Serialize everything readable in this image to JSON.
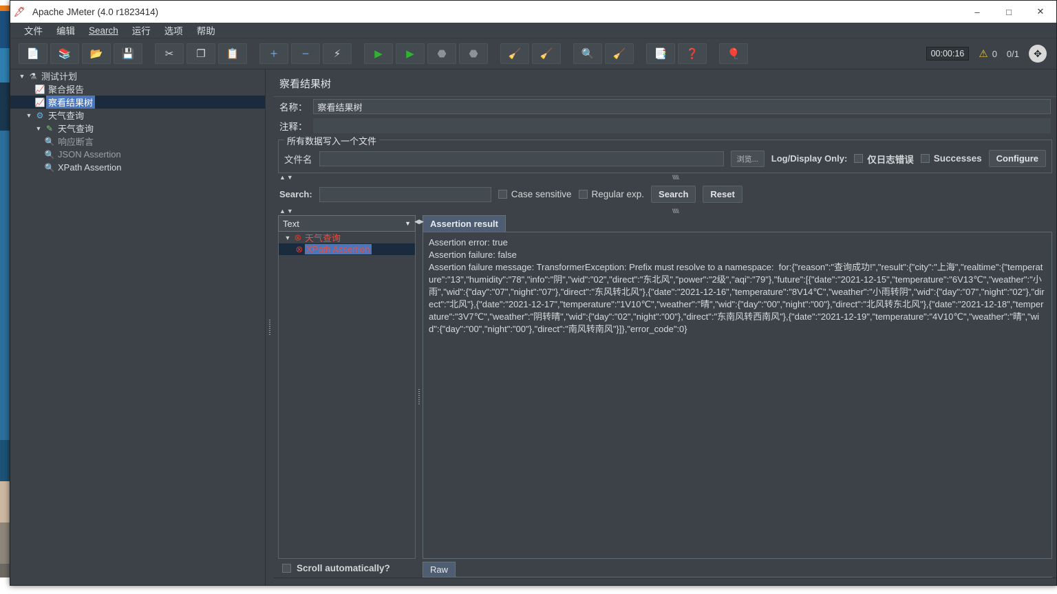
{
  "window": {
    "title": "Apache JMeter (4.0 r1823414)",
    "app_icon": "jmeter-feather-icon",
    "minimize_label": "–",
    "maximize_label": "□",
    "close_label": "✕"
  },
  "menubar": {
    "items": [
      {
        "label": "文件",
        "mnemonic": ""
      },
      {
        "label": "编辑",
        "mnemonic": ""
      },
      {
        "label": "Search",
        "mnemonic": "S"
      },
      {
        "label": "运行",
        "mnemonic": ""
      },
      {
        "label": "选项",
        "mnemonic": ""
      },
      {
        "label": "帮助",
        "mnemonic": ""
      }
    ]
  },
  "toolbar": {
    "buttons": [
      {
        "name": "new-button",
        "glyph": "📄"
      },
      {
        "name": "templates-button",
        "glyph": "📚"
      },
      {
        "name": "open-button",
        "glyph": "📂"
      },
      {
        "name": "save-button",
        "glyph": "💾"
      },
      {
        "name": "cut-button",
        "glyph": "✂"
      },
      {
        "name": "copy-button",
        "glyph": "📋"
      },
      {
        "name": "paste-button",
        "glyph": "📄"
      },
      {
        "name": "expand-all-button",
        "glyph": "+"
      },
      {
        "name": "collapse-all-button",
        "glyph": "−"
      },
      {
        "name": "toggle-button",
        "glyph": "⚡"
      },
      {
        "name": "start-button",
        "glyph": "▶"
      },
      {
        "name": "start-no-pauses-button",
        "glyph": "▶"
      },
      {
        "name": "stop-button",
        "glyph": "⬣"
      },
      {
        "name": "shutdown-button",
        "glyph": "⬣"
      },
      {
        "name": "clear-button",
        "glyph": "🧹"
      },
      {
        "name": "clear-all-button",
        "glyph": "🧹"
      },
      {
        "name": "search-button",
        "glyph": "🔍"
      },
      {
        "name": "reset-search-button",
        "glyph": "🧹"
      },
      {
        "name": "function-helper-button",
        "glyph": "📋"
      },
      {
        "name": "help-button",
        "glyph": "❓"
      },
      {
        "name": "undo-button",
        "glyph": "🎈"
      }
    ],
    "elapsed_time": "00:00:16",
    "warning_count": "0",
    "thread_counts": "0/1",
    "warning_icon": "warning-triangle-icon",
    "status_icon": "connection-status-icon"
  },
  "tree": {
    "nodes": [
      {
        "label": "测试计划",
        "icon": "test-plan-icon",
        "toggle": "▼",
        "depth": 0,
        "state": "normal"
      },
      {
        "label": "聚合报告",
        "icon": "aggregate-report-icon",
        "toggle": "",
        "depth": 1,
        "state": "normal"
      },
      {
        "label": "察看结果树",
        "icon": "view-results-tree-icon",
        "toggle": "",
        "depth": 1,
        "state": "selected"
      },
      {
        "label": "天气查询",
        "icon": "thread-group-icon",
        "toggle": "▼",
        "depth": 1,
        "state": "normal"
      },
      {
        "label": "天气查询",
        "icon": "http-sampler-icon",
        "toggle": "▼",
        "depth": 2,
        "state": "normal"
      },
      {
        "label": "响应断言",
        "icon": "assertion-icon",
        "toggle": "",
        "depth": 3,
        "state": "dim"
      },
      {
        "label": "JSON Assertion",
        "icon": "assertion-icon",
        "toggle": "",
        "depth": 3,
        "state": "dim"
      },
      {
        "label": "XPath Assertion",
        "icon": "assertion-icon",
        "toggle": "",
        "depth": 3,
        "state": "normal"
      }
    ]
  },
  "panel": {
    "title": "察看结果树",
    "name_label": "名称：",
    "name_value": "察看结果树",
    "comment_label": "注释：",
    "comment_value": "",
    "filegroup": {
      "title": "所有数据写入一个文件",
      "filename_label": "文件名",
      "filename_value": "",
      "browse_label": "浏览...",
      "logdisplay_label": "Log/Display Only:",
      "errors_only_label": "仅日志错误",
      "errors_only_checked": false,
      "successes_label": "Successes",
      "successes_checked": false,
      "configure_label": "Configure"
    },
    "search": {
      "label": "Search:",
      "value": "",
      "case_sensitive_label": "Case sensitive",
      "case_sensitive_checked": false,
      "regex_label": "Regular exp.",
      "regex_checked": false,
      "search_button": "Search",
      "reset_button": "Reset"
    }
  },
  "results": {
    "render_selector": "Text",
    "nodes": [
      {
        "label": "天气查询",
        "toggle": "▼",
        "depth": 0,
        "status": "error",
        "selected": false
      },
      {
        "label": "XPath Assertion",
        "toggle": "",
        "depth": 1,
        "status": "error",
        "selected": true
      }
    ],
    "scroll_label": "Scroll automatically?",
    "scroll_checked": false,
    "tab_label": "Assertion result",
    "raw_label": "Raw",
    "assertion_lines": [
      "Assertion error: true",
      "Assertion failure: false",
      "Assertion failure message: TransformerException: Prefix must resolve to a namespace:  for:{\"reason\":\"查询成功!\",\"result\":{\"city\":\"上海\",\"realtime\":{\"temperature\":\"13\",\"humidity\":\"78\",\"info\":\"阴\",\"wid\":\"02\",\"direct\":\"东北风\",\"power\":\"2级\",\"aqi\":\"79\"},\"future\":[{\"date\":\"2021-12-15\",\"temperature\":\"6V13℃\",\"weather\":\"小雨\",\"wid\":{\"day\":\"07\",\"night\":\"07\"},\"direct\":\"东风转北风\"},{\"date\":\"2021-12-16\",\"temperature\":\"8V14℃\",\"weather\":\"小雨转阴\",\"wid\":{\"day\":\"07\",\"night\":\"02\"},\"direct\":\"北风\"},{\"date\":\"2021-12-17\",\"temperature\":\"1V10℃\",\"weather\":\"晴\",\"wid\":{\"day\":\"00\",\"night\":\"00\"},\"direct\":\"北风转东北风\"},{\"date\":\"2021-12-18\",\"temperature\":\"3V7℃\",\"weather\":\"阴转晴\",\"wid\":{\"day\":\"02\",\"night\":\"00\"},\"direct\":\"东南风转西南风\"},{\"date\":\"2021-12-19\",\"temperature\":\"4V10℃\",\"weather\":\"晴\",\"wid\":{\"day\":\"00\",\"night\":\"00\"},\"direct\":\"南风转南风\"}]},\"error_code\":0}"
    ]
  }
}
